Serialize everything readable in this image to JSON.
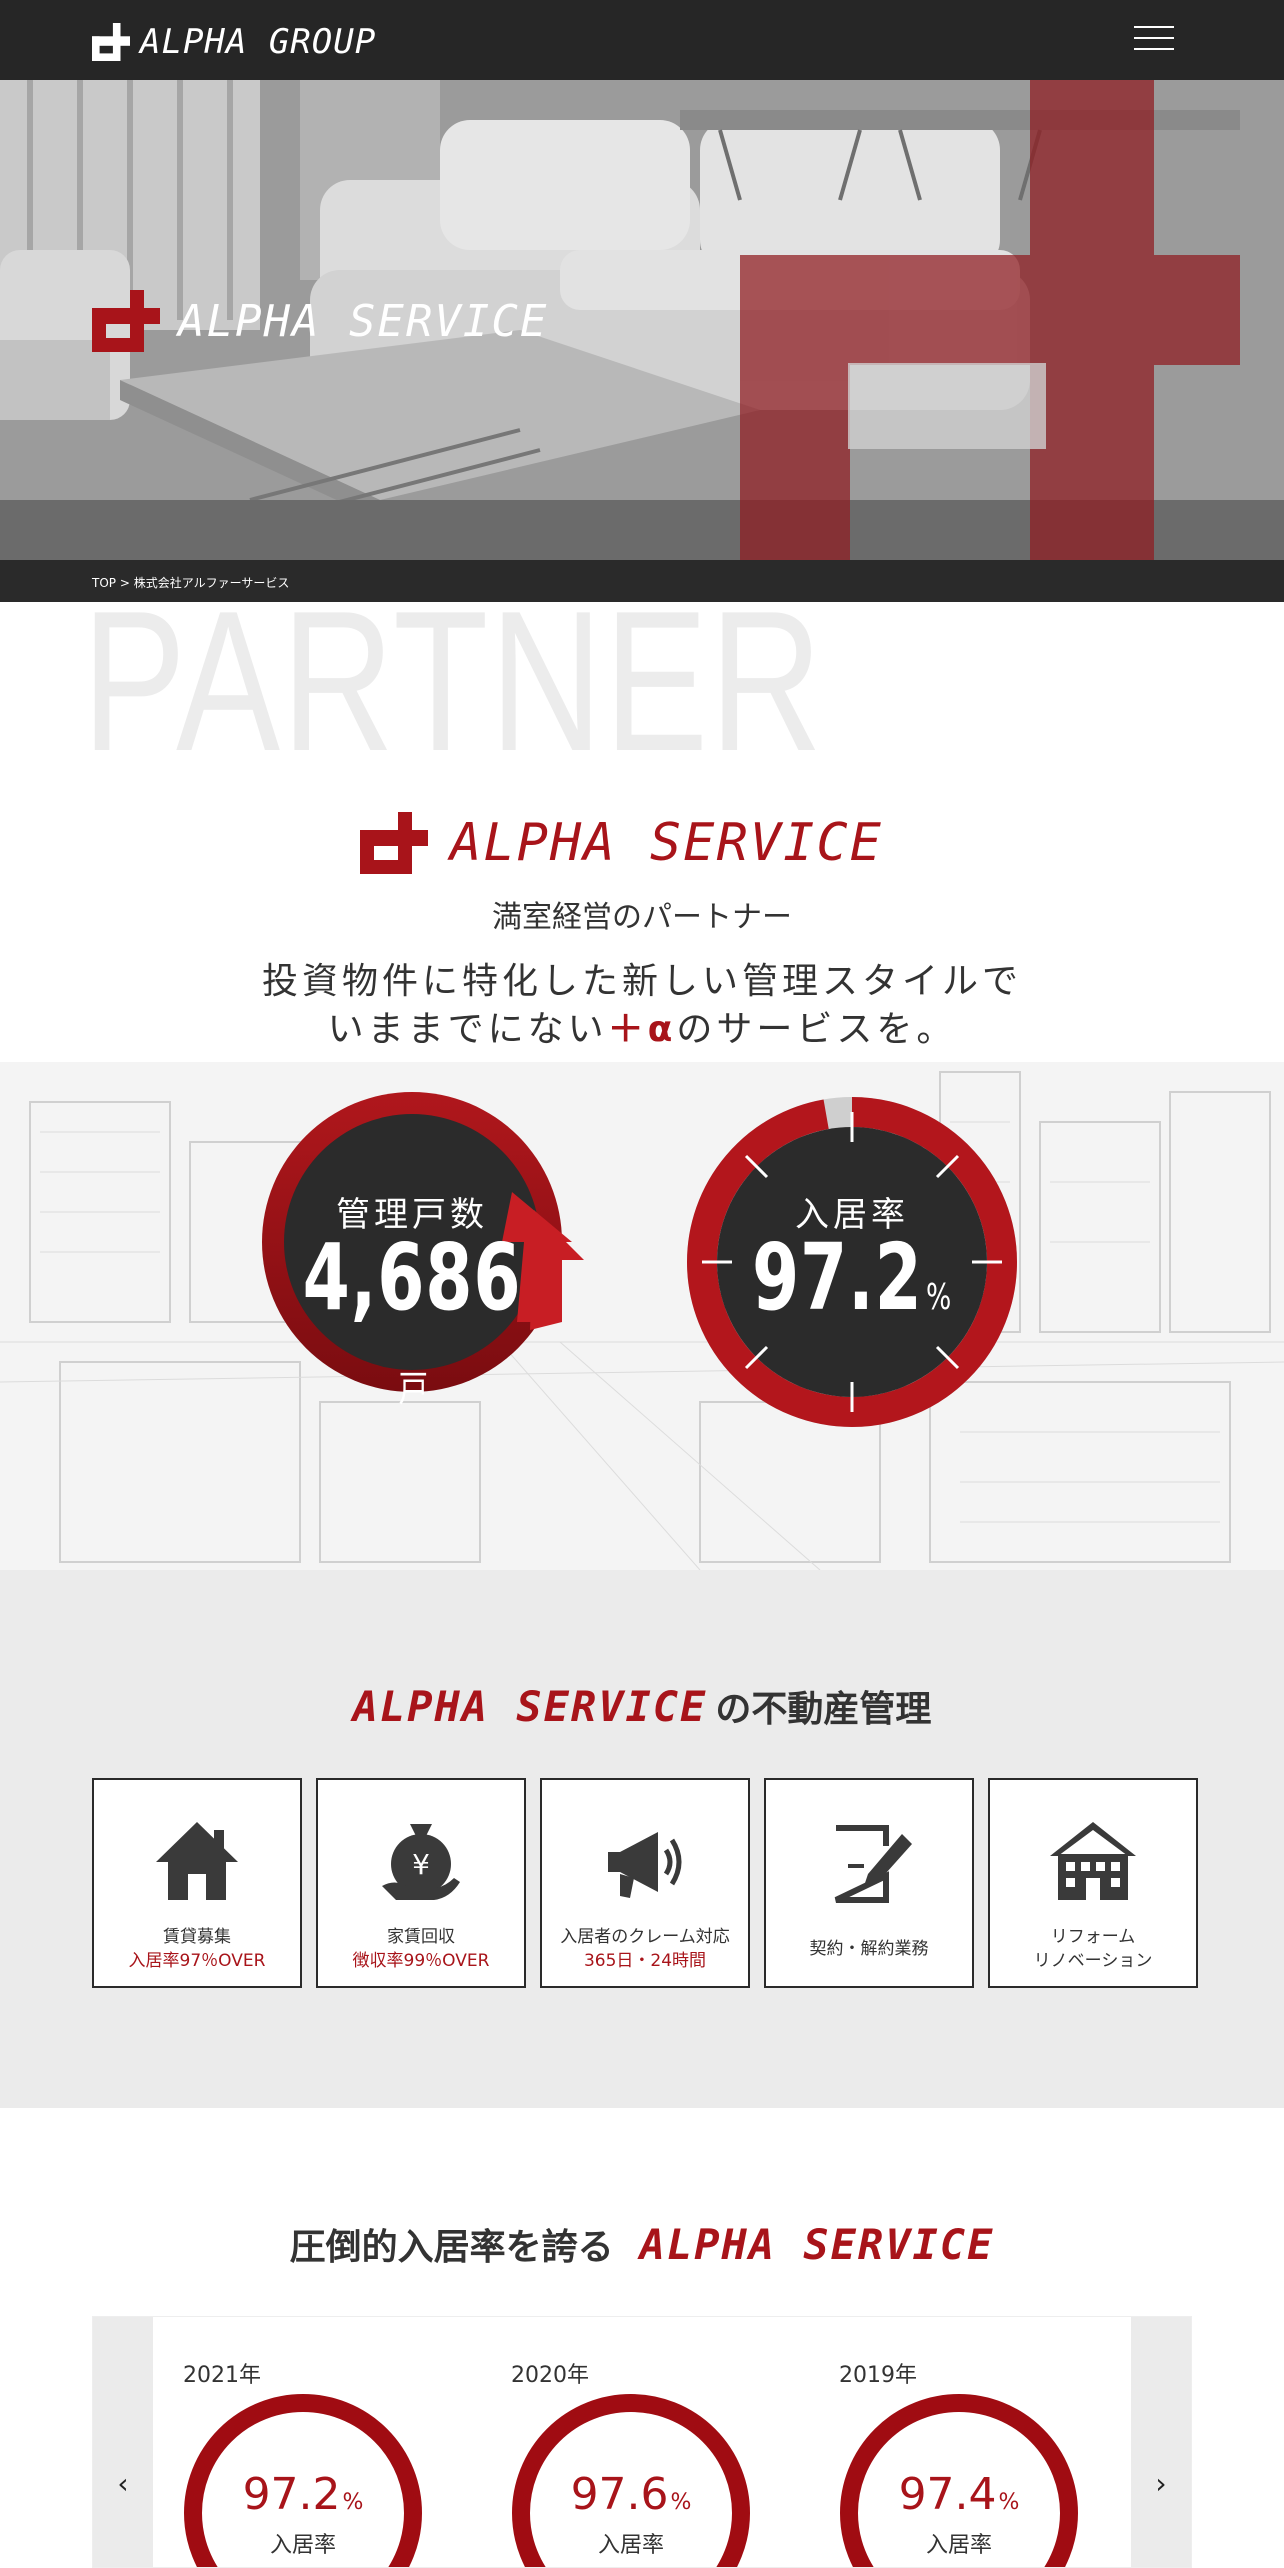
{
  "header": {
    "brand": "ALPHA GROUP",
    "menu_icon": "hamburger-menu-icon"
  },
  "hero": {
    "title": "ALPHA SERVICE"
  },
  "breadcrumb": {
    "home": "TOP",
    "separator": ">",
    "current": "株式会社アルファーサービス"
  },
  "partner": {
    "watermark": "PARTNER",
    "logo_text": "ALPHA SERVICE",
    "subtitle": "満室経営のパートナー",
    "lead_line1": "投資物件に特化した新しい管理スタイルで",
    "lead_line2_pre": "いままでにない",
    "lead_line2_alpha": "＋α",
    "lead_line2_post": "のサービスを。",
    "stats": [
      {
        "label": "管理戸数",
        "value": "4,686",
        "unit": "戸"
      },
      {
        "label": "入居率",
        "value": "97.2",
        "unit": "%",
        "percent": 97.2
      }
    ]
  },
  "management": {
    "title_en": "ALPHA SERVICE",
    "title_jp": "の不動産管理",
    "cards": [
      {
        "icon": "house-icon",
        "line1": "賃貸募集",
        "line2": "入居率97％OVER",
        "highlight": true
      },
      {
        "icon": "yen-bag-icon",
        "line1": "家賃回収",
        "line2": "徴収率99％OVER",
        "highlight": true
      },
      {
        "icon": "megaphone-icon",
        "line1": "入居者のクレーム対応",
        "line2": "365日・24時間",
        "highlight": true
      },
      {
        "icon": "contract-pen-icon",
        "line1": "契約・解約業務",
        "line2": "",
        "highlight": false
      },
      {
        "icon": "buildings-icon",
        "line1": "リフォーム",
        "line2": "リノベーション",
        "highlight": false
      }
    ]
  },
  "occupancy": {
    "title_jp": "圧倒的入居率を誇る",
    "title_en": "ALPHA SERVICE",
    "prev_icon": "chevron-left-icon",
    "next_icon": "chevron-right-icon",
    "prev": "‹",
    "next": "›",
    "years": [
      {
        "year": "2021年",
        "rate": "97.2",
        "unit": "%",
        "label": "入居率"
      },
      {
        "year": "2020年",
        "rate": "97.6",
        "unit": "%",
        "label": "入居率"
      },
      {
        "year": "2019年",
        "rate": "97.4",
        "unit": "%",
        "label": "入居率"
      }
    ]
  },
  "colors": {
    "accent": "#a8141a",
    "dark": "#262626",
    "panel": "#ebebeb"
  }
}
